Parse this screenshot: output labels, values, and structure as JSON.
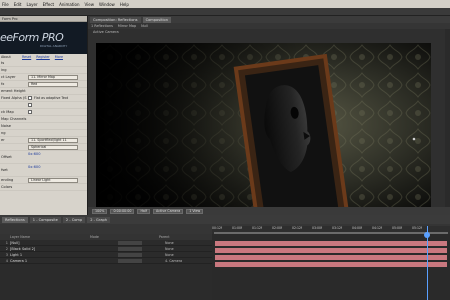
{
  "menu": [
    "File",
    "Edit",
    "Layer",
    "Effect",
    "Animation",
    "View",
    "Window",
    "Help"
  ],
  "effect_panel": {
    "title": "Form Pro",
    "logo_name": "eeForm PRO",
    "logo_tagline": "DIGITAL ANARCHY",
    "links": [
      "About",
      "Reset",
      "Register",
      "More"
    ],
    "rows": [
      {
        "label": "",
        "value": ""
      },
      {
        "label": "ts",
        "value": ""
      },
      {
        "label": "",
        "value": ""
      },
      {
        "label": "ing",
        "value": ""
      },
      {
        "label": "ct Layer",
        "dropdown": "11. Mirror Map"
      },
      {
        "label": "fx",
        "dropdown": "Red"
      },
      {
        "label": "ement Height",
        "value": ""
      },
      {
        "label": "Fixed Alpha (S",
        "checkbox": "Flat as adaptive Text"
      },
      {
        "label": "",
        "checkbox": ""
      },
      {
        "label": "ck Map",
        "checkbox": ""
      },
      {
        "label": "Map Channels",
        "value": ""
      },
      {
        "label": "Noise",
        "value": ""
      },
      {
        "label": "",
        "value": ""
      },
      {
        "label": "ng",
        "value": ""
      },
      {
        "label": "er",
        "dropdown": "11. Sportflexi/light 11"
      },
      {
        "label": "",
        "dropdown": "Spherical"
      },
      {
        "label": "",
        "value": ""
      },
      {
        "label": "Offset",
        "value": "0x:600"
      },
      {
        "label": "",
        "value": ""
      },
      {
        "label": "fset",
        "value": "0x:600"
      },
      {
        "label": "",
        "value": ""
      },
      {
        "label": "ending",
        "dropdown": "Linear Light"
      }
    ],
    "footer": "Colors"
  },
  "comp": {
    "tabs": [
      "Composition: Reflections",
      "Composition"
    ],
    "sub": [
      "1  Reflections",
      "Mirror Map",
      "Null"
    ],
    "view_label": "Active Camera",
    "footer": [
      "100%",
      "0:00:00:00",
      "Half",
      "Active Camera",
      "1 View"
    ]
  },
  "timeline": {
    "tabs": [
      "Reflections",
      "1 - Composite",
      "2 - Comp",
      "2 - Graph"
    ],
    "col_headers": [
      "Layer Name",
      "Mode",
      "Parent"
    ],
    "ruler": [
      "00:12f",
      "01:00f",
      "01:12f",
      "02:00f",
      "02:12f",
      "03:00f",
      "03:12f",
      "04:00f",
      "04:12f",
      "05:00f",
      "05:12f"
    ],
    "layers": [
      {
        "num": "1",
        "name": "[Null]",
        "parent": "None",
        "color": "#c9787f"
      },
      {
        "num": "2",
        "name": "[Black Solid 2]",
        "parent": "None",
        "color": "#c9787f"
      },
      {
        "num": "3",
        "name": "Light 1",
        "parent": "None",
        "color": "#c9787f"
      },
      {
        "num": "4",
        "name": "Camera 1",
        "parent": "4. Camera",
        "color": "#c9787f"
      }
    ]
  }
}
